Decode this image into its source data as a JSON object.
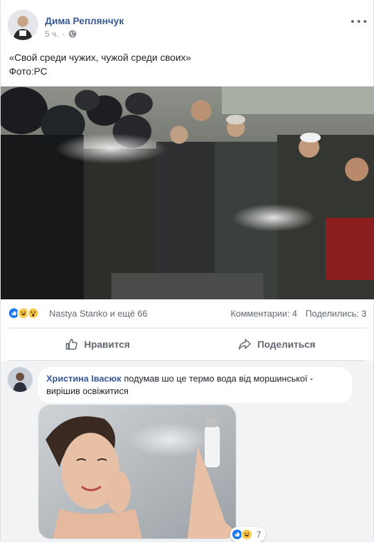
{
  "post": {
    "author": "Дима Реплянчук",
    "time": "5 ч.",
    "privacy_icon": "globe-icon",
    "text_line1": "«Свой среди чужих, чужой среди своих»",
    "text_line2": "Фото:РС",
    "photo_icon": "protest-photo"
  },
  "reactions": {
    "icons": [
      "like-icon",
      "haha-icon",
      "wow-icon"
    ],
    "names": "Nastya Stanko и ещё 66",
    "comments": "Комментарии: 4",
    "shares": "Поделились: 3"
  },
  "actions": {
    "like_label": "Нравится",
    "share_label": "Поделиться"
  },
  "comment": {
    "author": "Христина Івасюк",
    "text": "подумав шо це термо вода від моршинської - вирішив освіжитися",
    "photo_icon": "woman-spray-photo",
    "reaction_count": "7"
  },
  "colors": {
    "link": "#385898",
    "muted": "#606770",
    "like_blue": "#1877f2",
    "haha_yellow": "#f7c948"
  }
}
